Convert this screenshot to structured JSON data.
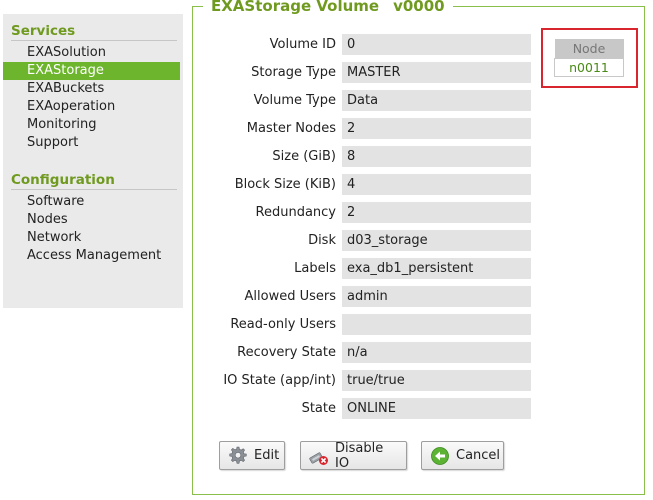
{
  "sidebar": {
    "services_title": "Services",
    "services": [
      {
        "label": "EXASolution",
        "active": false
      },
      {
        "label": "EXAStorage",
        "active": true
      },
      {
        "label": "EXABuckets",
        "active": false
      },
      {
        "label": "EXAoperation",
        "active": false
      },
      {
        "label": "Monitoring",
        "active": false
      },
      {
        "label": "Support",
        "active": false
      }
    ],
    "configuration_title": "Configuration",
    "configuration": [
      {
        "label": "Software"
      },
      {
        "label": "Nodes"
      },
      {
        "label": "Network"
      },
      {
        "label": "Access Management"
      }
    ]
  },
  "volume": {
    "legend_title": "EXAStorage Volume",
    "legend_version": "v0000",
    "fields": [
      {
        "label": "Volume ID",
        "value": "0"
      },
      {
        "label": "Storage Type",
        "value": "MASTER"
      },
      {
        "label": "Volume Type",
        "value": "Data"
      },
      {
        "label": "Master Nodes",
        "value": "2"
      },
      {
        "label": "Size (GiB)",
        "value": "8"
      },
      {
        "label": "Block Size (KiB)",
        "value": "4"
      },
      {
        "label": "Redundancy",
        "value": "2"
      },
      {
        "label": "Disk",
        "value": "d03_storage"
      },
      {
        "label": "Labels",
        "value": "exa_db1_persistent"
      },
      {
        "label": "Allowed Users",
        "value": "admin"
      },
      {
        "label": "Read-only Users",
        "value": ""
      },
      {
        "label": "Recovery State",
        "value": "n/a"
      },
      {
        "label": "IO State (app/int)",
        "value": "true/true"
      },
      {
        "label": "State",
        "value": "ONLINE"
      }
    ]
  },
  "node_table": {
    "header": "Node",
    "value": "n0011"
  },
  "buttons": {
    "edit": "Edit",
    "disable_io": "Disable IO",
    "cancel": "Cancel"
  },
  "colors": {
    "accent": "#6cb52d",
    "section_title": "#6f9a1f",
    "highlight": "#d9262e"
  }
}
